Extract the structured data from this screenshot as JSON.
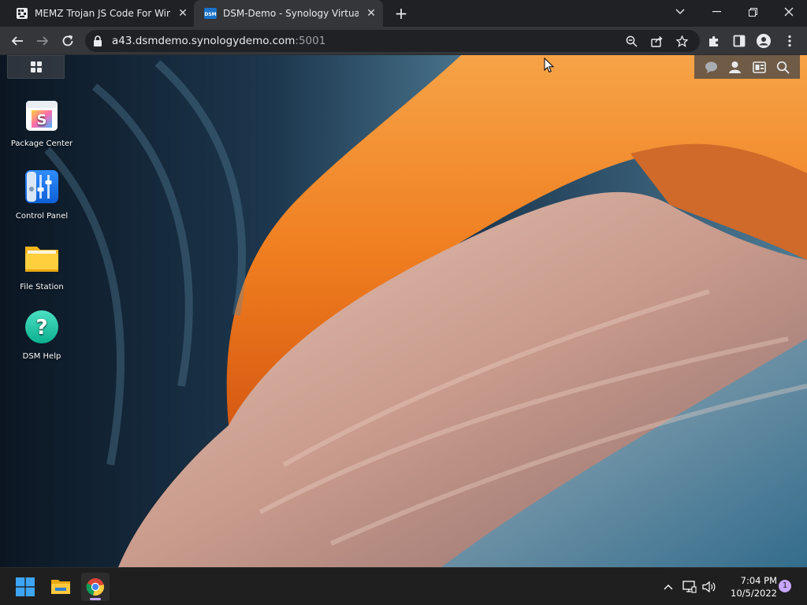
{
  "browser": {
    "tabs": [
      {
        "title": "MEMZ Trojan JS Code For Windo",
        "active": false
      },
      {
        "title": "DSM-Demo - Synology VirtualDS",
        "active": true
      }
    ],
    "url": {
      "host": "a43.dsmdemo.synologydemo.com",
      "port": ":5001"
    }
  },
  "desktop_icons": [
    {
      "label": "Package Center",
      "icon": "package-center-icon"
    },
    {
      "label": "Control Panel",
      "icon": "control-panel-icon"
    },
    {
      "label": "File Station",
      "icon": "file-station-icon"
    },
    {
      "label": "DSM Help",
      "icon": "dsm-help-icon"
    }
  ],
  "taskbar": {
    "time": "7:04 PM",
    "date": "10/5/2022",
    "notification_count": "1"
  },
  "colors": {
    "accent_tab": "#35363a",
    "chrome_bg": "#202124",
    "taskbar_bg": "#1f1f1f",
    "notification_badge": "#c9a6ff"
  }
}
